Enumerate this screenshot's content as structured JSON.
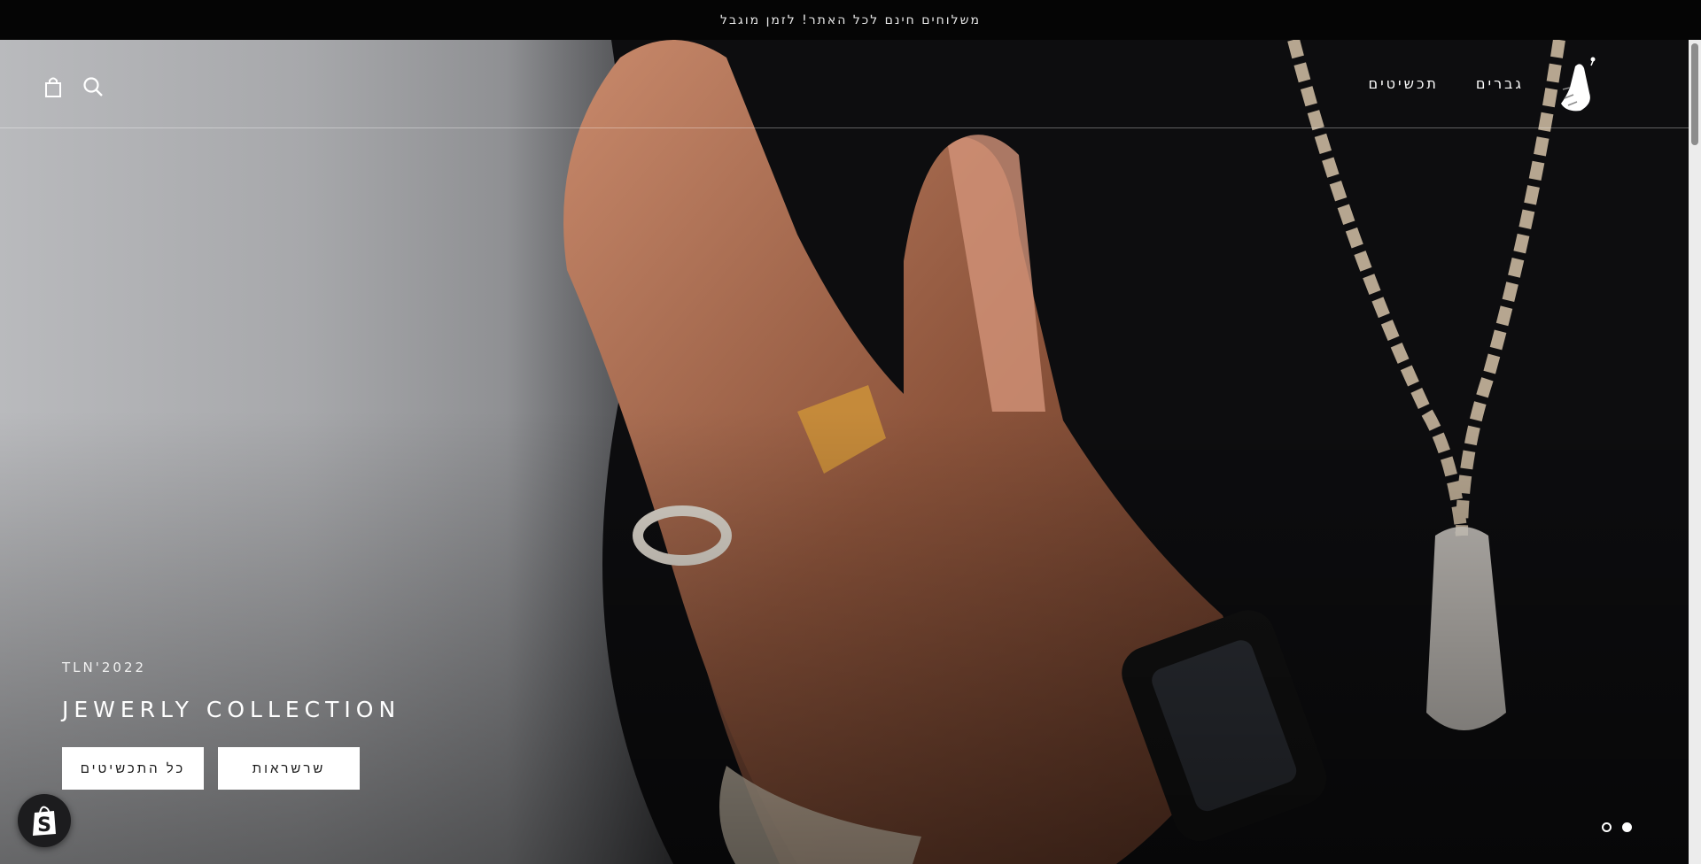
{
  "announcement": {
    "text": "משלוחים חינם לכל האתר! לזמן מוגבל"
  },
  "header": {
    "nav": [
      {
        "label": "גברים"
      },
      {
        "label": "תכשיטים"
      }
    ],
    "icons": {
      "logo": "praying-hands-logo",
      "search": "search-icon",
      "cart": "shopping-bag-icon"
    }
  },
  "hero": {
    "tagline": "TLN'2022",
    "title": "JEWERLY COLLECTION",
    "buttons": [
      {
        "label": "כל התכשיטים"
      },
      {
        "label": "שרשראות"
      }
    ],
    "slides_total": 2,
    "active_slide": 1
  },
  "badge": {
    "icon": "shopify-bag-icon"
  },
  "colors": {
    "announcement_bg": "#050505",
    "button_bg": "#ffffff",
    "text_light": "#ffffff"
  }
}
